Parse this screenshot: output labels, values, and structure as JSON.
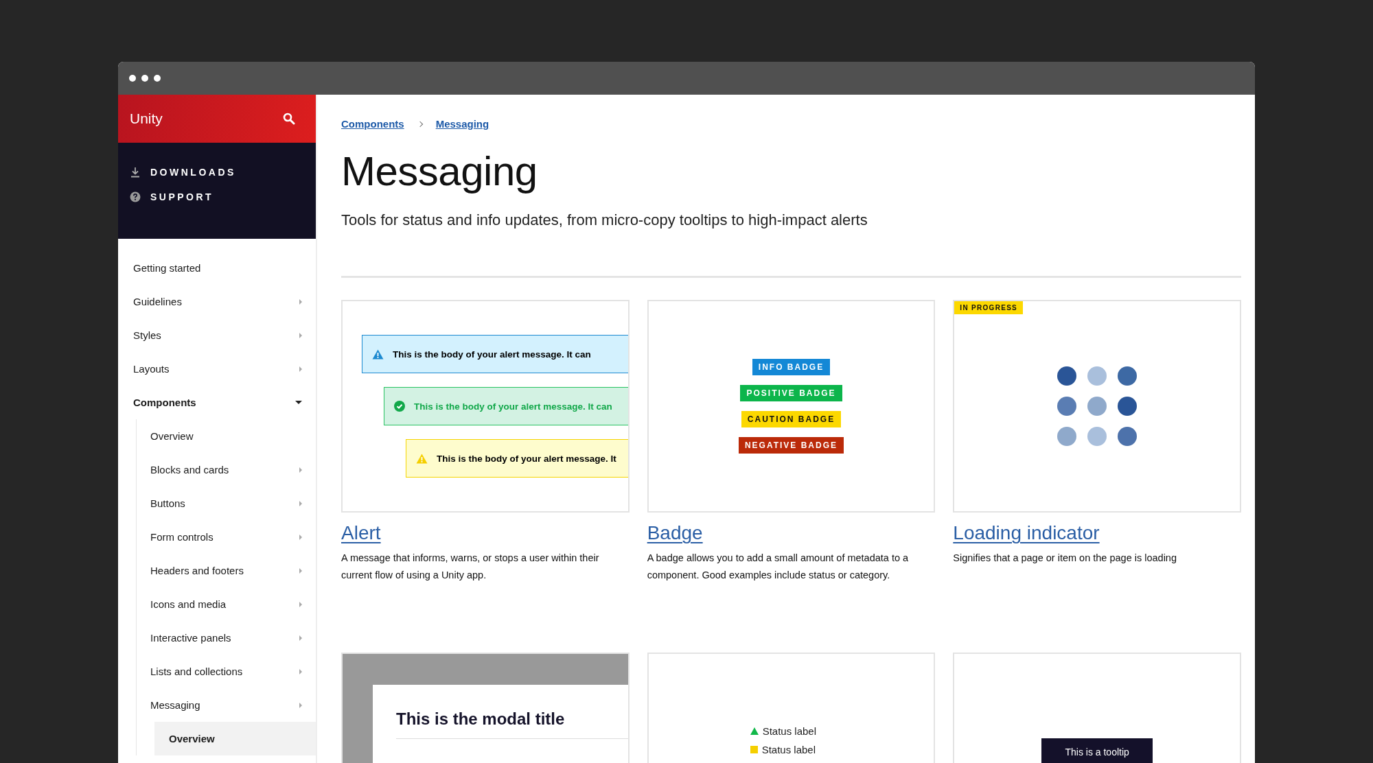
{
  "brand": {
    "title": "Unity"
  },
  "top_links": [
    {
      "label": "DOWNLOADS",
      "kind": "download"
    },
    {
      "label": "SUPPORT",
      "kind": "help"
    }
  ],
  "sidebar": {
    "items": [
      {
        "label": "Getting started",
        "selected": false
      },
      {
        "label": "Guidelines",
        "expanded": false,
        "selected": false
      },
      {
        "label": "Styles",
        "expanded": false,
        "selected": false
      },
      {
        "label": "Layouts",
        "expanded": false,
        "selected": false
      },
      {
        "label": "Components",
        "expanded": true,
        "selected": false,
        "children": [
          {
            "label": "Overview",
            "selected": false
          },
          {
            "label": "Blocks and cards",
            "expanded": false,
            "selected": false
          },
          {
            "label": "Buttons",
            "expanded": false,
            "selected": false
          },
          {
            "label": "Form controls",
            "expanded": false,
            "selected": false
          },
          {
            "label": "Headers and footers",
            "expanded": false,
            "selected": false
          },
          {
            "label": "Icons and media",
            "expanded": false,
            "selected": false
          },
          {
            "label": "Interactive panels",
            "expanded": false,
            "selected": false
          },
          {
            "label": "Lists and collections",
            "expanded": false,
            "selected": false
          },
          {
            "label": "Messaging",
            "expanded": false,
            "selected": false,
            "children": [
              {
                "label": "Overview",
                "selected": true
              }
            ]
          }
        ]
      }
    ]
  },
  "breadcrumb": [
    "Components",
    "Messaging"
  ],
  "page": {
    "title": "Messaging",
    "subtitle": "Tools for status and info updates, from micro-copy tooltips to high-impact alerts"
  },
  "cards": [
    {
      "kind": "alert",
      "title": "Alert",
      "description": "A message that informs, warns, or stops a user within their current flow of using a Unity app.",
      "alerts": [
        {
          "kind": "info",
          "text": "This is the body of your alert message. It can"
        },
        {
          "kind": "success",
          "text": "This is the body of your alert message. It can"
        },
        {
          "kind": "warning",
          "text": "This is the body of your alert message. It"
        }
      ]
    },
    {
      "kind": "badge",
      "title": "Badge",
      "description": "A badge allows you to add a small amount of metadata to a component. Good examples include status or category.",
      "badges": [
        {
          "kind": "info",
          "label": "INFO BADGE"
        },
        {
          "kind": "positive",
          "label": "POSITIVE BADGE"
        },
        {
          "kind": "caution",
          "label": "CAUTION BADGE"
        },
        {
          "kind": "negative",
          "label": "NEGATIVE BADGE"
        }
      ]
    },
    {
      "kind": "loading",
      "title": "Loading indicator",
      "description": "Signifies that a page or item on the page is loading",
      "tag": "IN PROGRESS",
      "dots": [
        {
          "color": "#2a5597"
        },
        {
          "color": "#a9bfdc"
        },
        {
          "color": "#3d69a4"
        },
        {
          "color": "#5a7db3"
        },
        {
          "color": "#8fa9cb"
        },
        {
          "color": "#2a5597"
        },
        {
          "color": "#8fa9cb"
        },
        {
          "color": "#a9bfdc"
        },
        {
          "color": "#4d72ab"
        }
      ]
    },
    {
      "kind": "modal",
      "modal_title": "This is the modal title"
    },
    {
      "kind": "status",
      "labels": [
        {
          "kind": "positive",
          "text": "Status label"
        },
        {
          "kind": "caution",
          "text": "Status label"
        }
      ]
    },
    {
      "kind": "tooltip",
      "tooltip": "This is a tooltip"
    }
  ]
}
